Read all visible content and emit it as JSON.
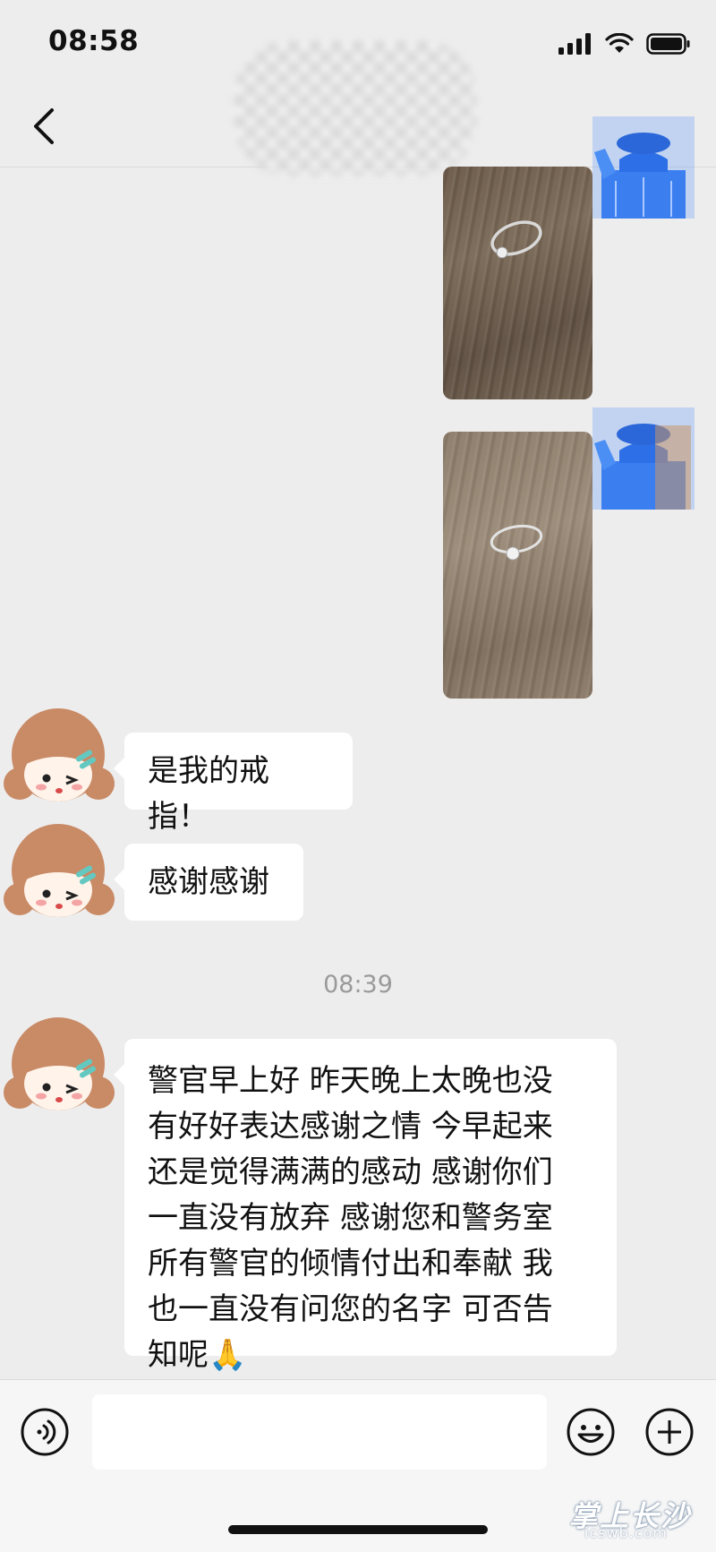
{
  "status_bar": {
    "time": "08:58"
  },
  "nav": {
    "title_obscured": ""
  },
  "messages": [
    {
      "side": "right",
      "kind": "image",
      "desc": "ring photo 1"
    },
    {
      "side": "right",
      "kind": "image",
      "desc": "ring photo 2"
    },
    {
      "side": "left",
      "kind": "text",
      "text": "是我的戒指！"
    },
    {
      "side": "left",
      "kind": "text",
      "text": "感谢感谢"
    },
    {
      "kind": "timestamp",
      "text": "08:39"
    },
    {
      "side": "left",
      "kind": "text",
      "text": "警官早上好 昨天晚上太晚也没\n有好好表达感谢之情 今早起来\n还是觉得满满的感动 感谢你们\n一直没有放弃 感谢您和警务室\n所有警官的倾情付出和奉献  我\n也一直没有问您的名字 可否告\n知呢🙏"
    }
  ],
  "input": {
    "value": ""
  },
  "watermark": {
    "main": "掌上长沙",
    "sub": "icswb.com"
  },
  "colors": {
    "background": "#ededed",
    "bubble": "#ffffff",
    "avatar_blue": "#4a8cf0"
  }
}
